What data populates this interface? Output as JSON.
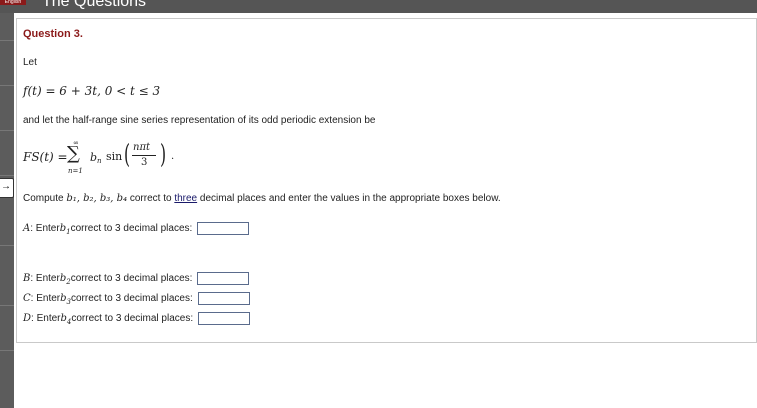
{
  "header": {
    "brand": "English",
    "title": "The Questions"
  },
  "sidebar": {
    "tab_icon": "→"
  },
  "question": {
    "title": "Question 3.",
    "intro": "Let",
    "function": "f(t) = 6 + 3t, 0 < t ≤ 3",
    "instruction": "and let the half-range sine series representation of its odd periodic extension be",
    "series": {
      "lhs": "FS(t) =",
      "upper_limit": "∞",
      "sigma": "∑",
      "lower_limit": "n=1",
      "coef": "b",
      "coef_sub": "n",
      "func": "sin",
      "numerator": "nπt",
      "denominator": "3",
      "end": "."
    },
    "compute_prefix": "Compute ",
    "compute_vars": "b₁, b₂, b₃, b₄",
    "compute_mid": " correct to ",
    "compute_link": "three",
    "compute_suffix": " decimal places and enter the values in the appropriate boxes below."
  },
  "answers": [
    {
      "letter": "A",
      "text_pre": ": Enter ",
      "var": "b",
      "sub": "1",
      "text_post": " correct to 3 decimal places:",
      "value": ""
    },
    {
      "letter": "B",
      "text_pre": ": Enter ",
      "var": "b",
      "sub": "2",
      "text_post": " correct to 3 decimal places:",
      "value": ""
    },
    {
      "letter": "C",
      "text_pre": ": Enter ",
      "var": "b",
      "sub": "3",
      "text_post": " correct to 3 decimal places:",
      "value": ""
    },
    {
      "letter": "D",
      "text_pre": ": Enter ",
      "var": "b",
      "sub": "4",
      "text_post": " correct to 3 decimal places:",
      "value": ""
    }
  ]
}
